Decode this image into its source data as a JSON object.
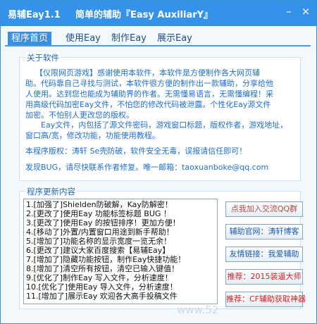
{
  "window": {
    "app_name": "易辅Eay1.1",
    "subtitle": "简单的辅助『Easy AuxiliarY』",
    "minimize_glyph": "–",
    "close_glyph": "×"
  },
  "tabs": [
    {
      "label": "程序首页",
      "active": true
    },
    {
      "label": "使用Eay",
      "active": false
    },
    {
      "label": "制作Eay",
      "active": false
    },
    {
      "label": "展示Eay",
      "active": false
    }
  ],
  "about": {
    "title": "关于软件",
    "intro_lines": [
      "【仪限网页游戏】感谢使用本软件，本软件是方便制作各大网页辅",
      "助。代码靠自己寻找与测试，本软件很方便的制作出一款辅助，分享给他",
      "人使用。达到您也能成为辅助界的作者。无需懂易语言，无需懂编程！采",
      "用高级代码加密Eay文件，不怕您的修改代码被泄露。个性化Eay源文件",
      "加密。不怕别人更改您的版权。"
    ],
    "file_lines": [
      "Eay文件，内包括了源文件密码，游戏窗口标题，版权作者，游戏地址，",
      "窗口高/宽，修改功能，功能使用教程。"
    ],
    "copyright_line": "本程序版权：涛轩      Se壳防破，软件安全无毒，误报请信任即可！",
    "bug_line": "发现BUG，请尽快联系作者修复。唯一邮箱：taoxuanboke@qq.com"
  },
  "changelog": {
    "title": "程序更新内容",
    "items": [
      "1.[加强了]Shielden防破解，Kay防解密！",
      "2.[更改了]使用Eay 功能标签标题 BUG ！",
      "3.[更改了]使用Eay 的按钮排序！更加方便！",
      "4.[移动了]外置/内置窗口用途到新手帮助！",
      "5.[增加了]功能名称的显示宽度一览无余！",
      "6.[更改了]建议大家百度搜索【易辅Eay】",
      "7.[增加了]隐藏功能按钮，制作Eay快捷功能！",
      "8.[增加了]清空所有按钮，清空已输入键值！",
      "9.[优化了]制作Eay 写入文件，分析速度！",
      "10.[优化了]使用Eay 导入文件，分析速度！",
      "11.[增加了]展示Eay 欢迎各大高手投稿文件"
    ]
  },
  "buttons": {
    "join_qq": "点我加入交流QQ群",
    "official_site": "辅助官网：涛轩博客",
    "friend_link": "友情链接：我爱辅助",
    "recommend_1": "推荐：2015装逼大师",
    "recommend_2": "推荐：CF辅助获取神器"
  },
  "watermark": "www.52"
}
